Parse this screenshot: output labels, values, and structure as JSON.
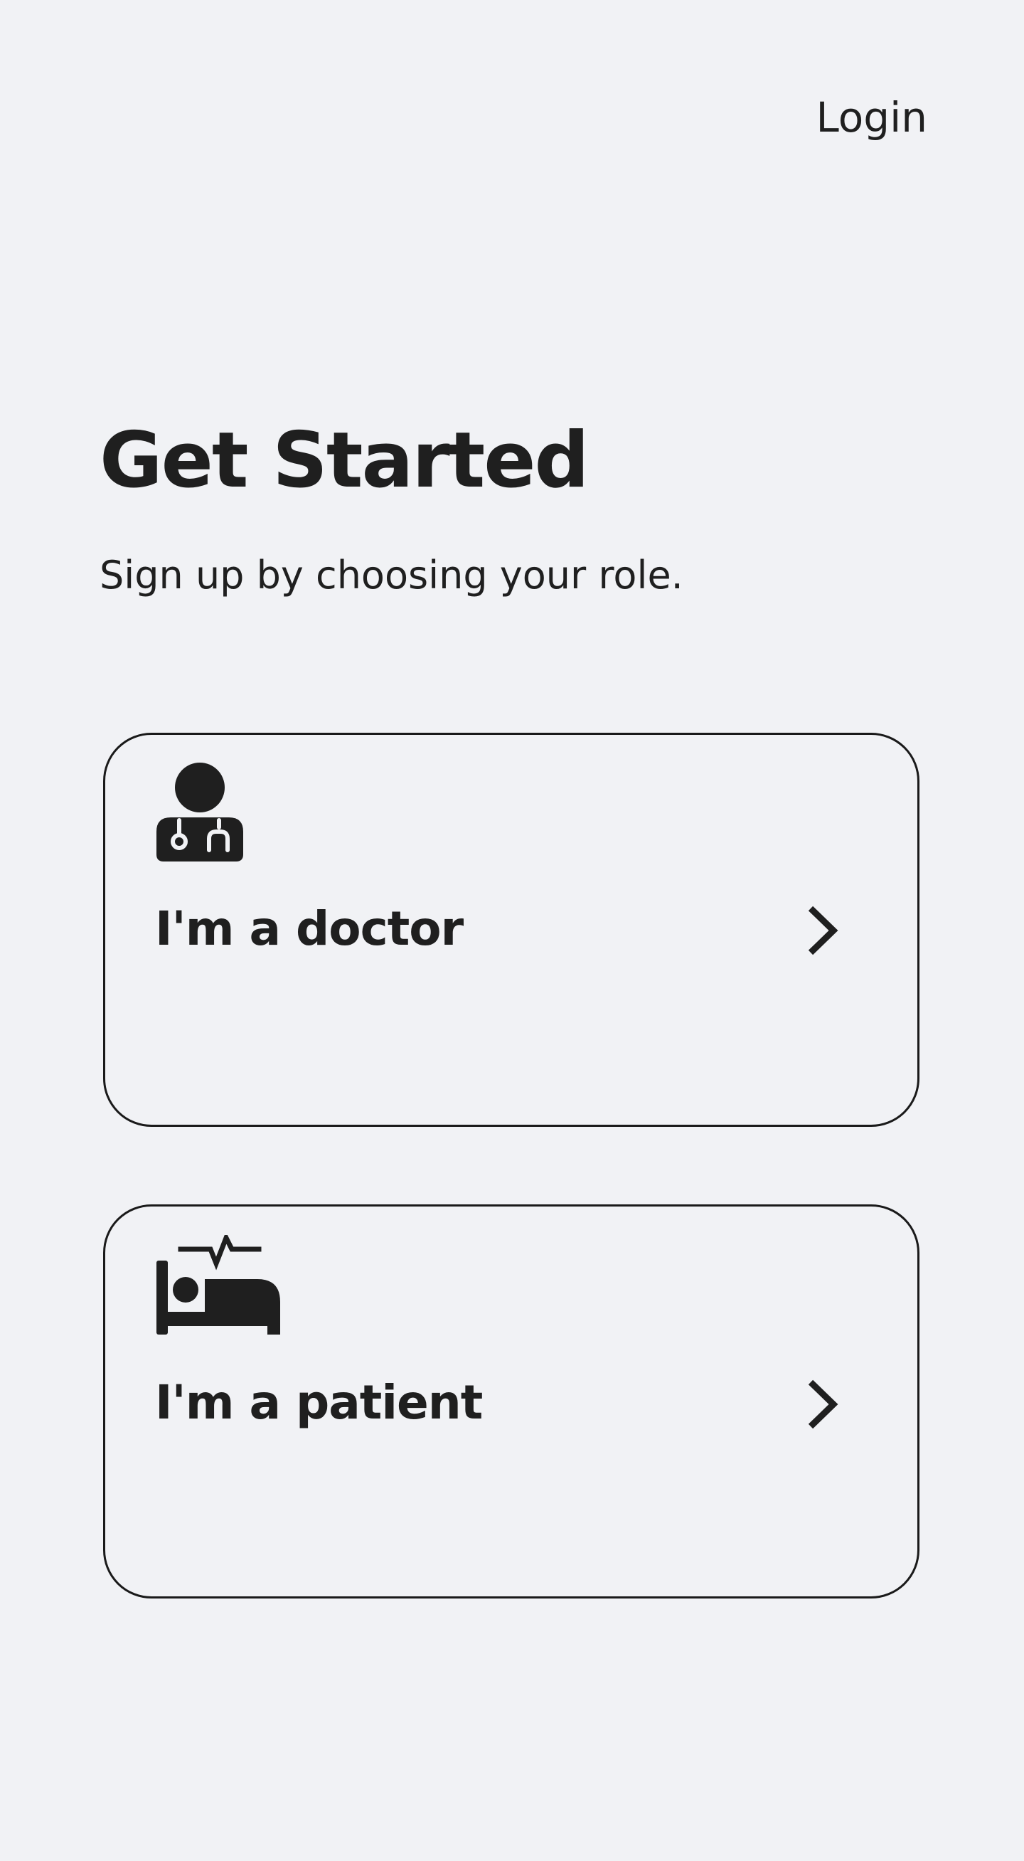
{
  "header": {
    "login_label": "Login"
  },
  "main": {
    "title": "Get Started",
    "subtitle": "Sign up by choosing your role.",
    "roles": [
      {
        "label": "I'm a doctor",
        "icon": "doctor-icon"
      },
      {
        "label": "I'm a patient",
        "icon": "patient-bed-icon"
      }
    ]
  },
  "colors": {
    "background": "#f1f2f5",
    "text": "#1f1f1f",
    "card_border": "#1a1a1a"
  }
}
